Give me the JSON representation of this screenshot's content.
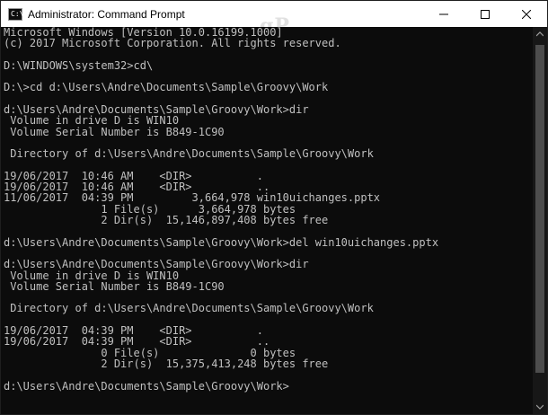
{
  "window": {
    "title": "Administrator: Command Prompt",
    "icon_name": "cmd-icon",
    "icon_glyph": "C:\\",
    "controls": {
      "minimize_icon": "minimize-icon",
      "maximize_icon": "maximize-icon",
      "close_icon": "close-icon"
    }
  },
  "watermark": "gP",
  "console": {
    "text_color": "#c0c0c0",
    "background_color": "#0c0c0c",
    "lines": [
      "Microsoft Windows [Version 10.0.16199.1000]",
      "(c) 2017 Microsoft Corporation. All rights reserved.",
      "",
      "D:\\WINDOWS\\system32>cd\\",
      "",
      "D:\\>cd d:\\Users\\Andre\\Documents\\Sample\\Groovy\\Work",
      "",
      "d:\\Users\\Andre\\Documents\\Sample\\Groovy\\Work>dir",
      " Volume in drive D is WIN10",
      " Volume Serial Number is B849-1C90",
      "",
      " Directory of d:\\Users\\Andre\\Documents\\Sample\\Groovy\\Work",
      "",
      "19/06/2017  10:46 AM    <DIR>          .",
      "19/06/2017  10:46 AM    <DIR>          ..",
      "11/06/2017  04:39 PM         3,664,978 win10uichanges.pptx",
      "               1 File(s)      3,664,978 bytes",
      "               2 Dir(s)  15,146,897,408 bytes free",
      "",
      "d:\\Users\\Andre\\Documents\\Sample\\Groovy\\Work>del win10uichanges.pptx",
      "",
      "d:\\Users\\Andre\\Documents\\Sample\\Groovy\\Work>dir",
      " Volume in drive D is WIN10",
      " Volume Serial Number is B849-1C90",
      "",
      " Directory of d:\\Users\\Andre\\Documents\\Sample\\Groovy\\Work",
      "",
      "19/06/2017  04:39 PM    <DIR>          .",
      "19/06/2017  04:39 PM    <DIR>          ..",
      "               0 File(s)              0 bytes",
      "               2 Dir(s)  15,375,413,248 bytes free",
      "",
      "d:\\Users\\Andre\\Documents\\Sample\\Groovy\\Work>"
    ]
  },
  "scrollbar": {
    "up_icon": "scroll-up-arrow-icon",
    "down_icon": "scroll-down-arrow-icon"
  }
}
